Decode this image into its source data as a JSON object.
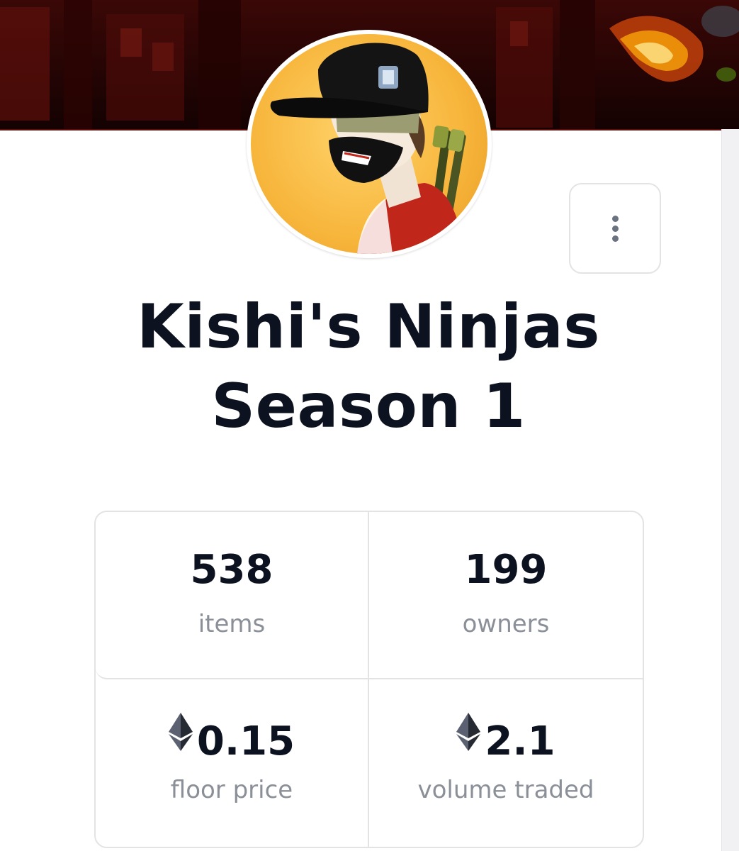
{
  "collection": {
    "title_line1": "Kishi's Ninjas",
    "title_line2": "Season 1"
  },
  "menu": {
    "icon": "more-vertical-icon"
  },
  "stats": [
    {
      "value": "538",
      "label": "items",
      "icon": ""
    },
    {
      "value": "199",
      "label": "owners",
      "icon": ""
    },
    {
      "value": "0.15",
      "label": "floor price",
      "icon": "ethereum-icon"
    },
    {
      "value": "2.1",
      "label": "volume traded",
      "icon": "ethereum-icon"
    }
  ],
  "colors": {
    "title": "#0d1220",
    "label": "#8a8f98",
    "border": "#e3e3e6",
    "avatar_bg": "#f7b53b"
  }
}
